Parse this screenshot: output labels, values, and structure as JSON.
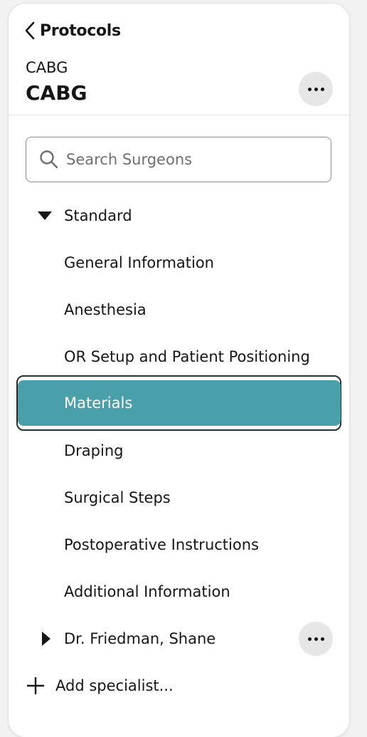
{
  "nav": {
    "back_label": "Protocols"
  },
  "header": {
    "subtitle": "CABG",
    "title": "CABG"
  },
  "search": {
    "placeholder": "Search Surgeons",
    "value": ""
  },
  "tree": {
    "groups": [
      {
        "label": "Standard",
        "expanded": true,
        "items": [
          {
            "label": "General Information"
          },
          {
            "label": "Anesthesia"
          },
          {
            "label": "OR Setup and Patient Positioning"
          },
          {
            "label": "Materials",
            "selected": true
          },
          {
            "label": "Draping"
          },
          {
            "label": "Surgical Steps"
          },
          {
            "label": "Postoperative Instructions"
          },
          {
            "label": "Additional Information"
          }
        ]
      },
      {
        "label": "Dr. Friedman, Shane",
        "expanded": false
      }
    ]
  },
  "actions": {
    "add_specialist_label": "Add specialist..."
  },
  "colors": {
    "selected_bg": "#4aa0aa",
    "selected_outline": "#203038",
    "more_button_bg": "#e6e6e6"
  },
  "icons": [
    "chevron-left-icon",
    "more-horizontal-icon",
    "search-icon",
    "caret-down-icon",
    "caret-right-icon",
    "plus-icon"
  ]
}
